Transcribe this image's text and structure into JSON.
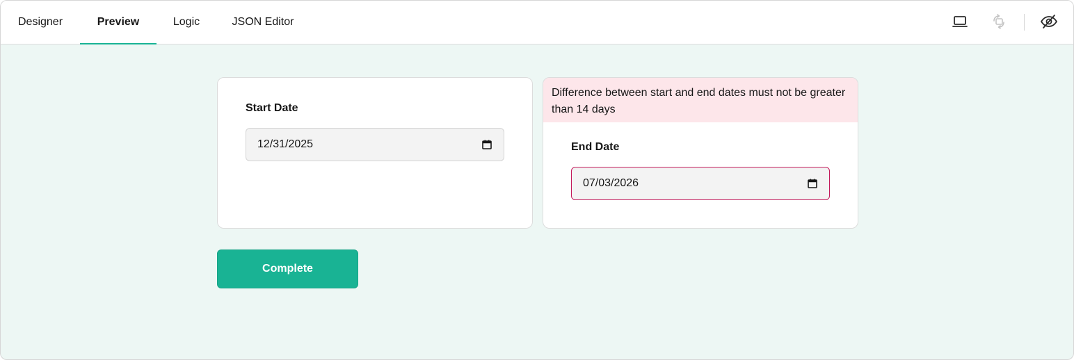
{
  "tabs": [
    {
      "label": "Designer"
    },
    {
      "label": "Preview"
    },
    {
      "label": "Logic"
    },
    {
      "label": "JSON Editor"
    }
  ],
  "active_tab": "Preview",
  "toolbar": {
    "icons": [
      "device-laptop-icon",
      "rotate-orientation-icon",
      "show-invisible-elements-icon"
    ]
  },
  "form": {
    "start_date": {
      "title": "Start Date",
      "value": "12/31/2025"
    },
    "end_date": {
      "error": "Difference between start and end dates must not be greater than 14 days",
      "title": "End Date",
      "value": "07/03/2026"
    },
    "complete_label": "Complete"
  },
  "colors": {
    "accent": "#19b394",
    "background": "#edf7f4",
    "error_background": "#fde6ea",
    "error_border": "#c3195a"
  }
}
